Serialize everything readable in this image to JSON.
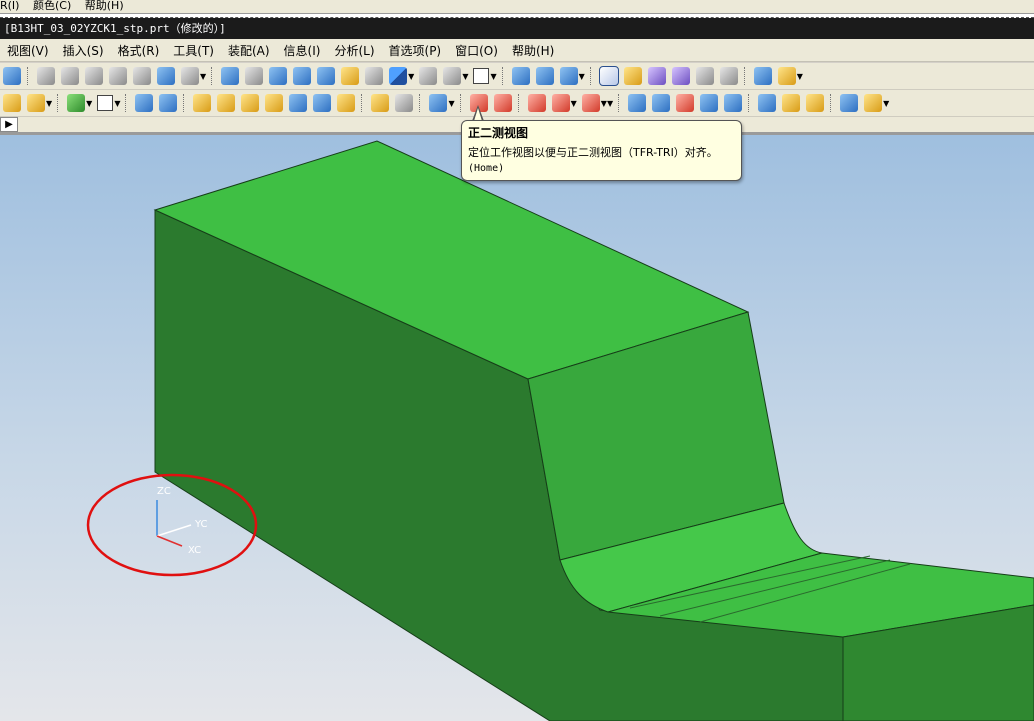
{
  "top_strip": {
    "items": [
      "R(I)",
      "颜色(C)",
      "帮助(H)"
    ]
  },
  "title_bar": {
    "title": "[B13HT_03_02YZCK1_stp.prt（修改的）]"
  },
  "menu": {
    "items": [
      "视图(V)",
      "插入(S)",
      "格式(R)",
      "工具(T)",
      "装配(A)",
      "信息(I)",
      "分析(L)",
      "首选项(P)",
      "窗口(O)",
      "帮助(H)"
    ]
  },
  "tooltip": {
    "title": "正二测视图",
    "description": "定位工作视图以便与正二测视图（TFR-TRI）对齐。",
    "shortcut": "(Home)"
  },
  "axes": {
    "z": "ZC",
    "y": "YC",
    "x": "XC"
  },
  "colors": {
    "model_top": "#3fbf44",
    "model_front": "#2b7a2e",
    "model_side": "#2f8830",
    "highlight_circle": "#e01010",
    "tooltip_bg": "#ffffe1"
  },
  "toolbar_icons": {
    "row1": [
      "save-icon",
      "cut-icon",
      "copy-icon",
      "paste-icon",
      "undo-icon",
      "redo-icon",
      "select-filter-icon",
      "snap-icon",
      "fit-icon",
      "zoom-window-icon",
      "zoom-icon",
      "rotate-icon",
      "pan-icon",
      "perspective-icon",
      "shaded-cube-icon",
      "render-style-icon",
      "edge-display-icon",
      "background-icon",
      "view-orient-icon",
      "view-rotate-icon",
      "view-triad-icon",
      "trimetric-view-icon",
      "dimetric-view-icon",
      "view-front-icon",
      "view-top-icon",
      "view-right-icon",
      "measure-icon",
      "ruler-icon"
    ],
    "row2": [
      "sketch-icon",
      "feature-icon",
      "datum-icon",
      "point-icon",
      "body-icon",
      "box-icon",
      "cylinder-icon",
      "cone-icon",
      "sphere-icon",
      "extrude-icon",
      "revolve-icon",
      "blend-icon",
      "chamfer-icon",
      "hole-icon",
      "shell-icon",
      "pattern-icon",
      "unite-icon",
      "subtract-icon",
      "edge-blend-icon",
      "curve-icon",
      "arc-icon",
      "trim-icon",
      "offset-icon",
      "draft-icon",
      "surface-icon",
      "sew-icon",
      "face-icon",
      "move-icon",
      "sheet-icon",
      "render-icon",
      "paint-icon"
    ]
  }
}
